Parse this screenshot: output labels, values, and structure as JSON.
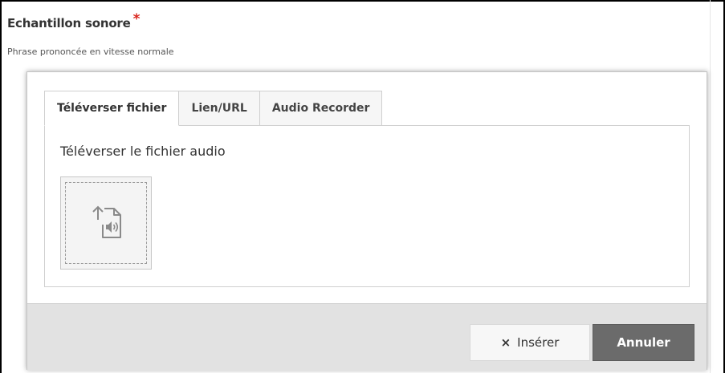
{
  "field": {
    "title": "Echantillon sonore",
    "required_mark": "*",
    "description": "Phrase prononcée en vitesse normale"
  },
  "dialog": {
    "tabs": [
      {
        "label": "Téléverser fichier",
        "active": true
      },
      {
        "label": "Lien/URL",
        "active": false
      },
      {
        "label": "Audio Recorder",
        "active": false
      }
    ],
    "panel_heading": "Téléverser le fichier audio",
    "upload_icon": "audio-file-upload-icon",
    "insert_icon": "×",
    "insert_label": "Insérer",
    "cancel_label": "Annuler"
  },
  "colors": {
    "required": "#d9251c",
    "cancel_button": "#6b6b6b",
    "footer": "#e2e2e2"
  }
}
